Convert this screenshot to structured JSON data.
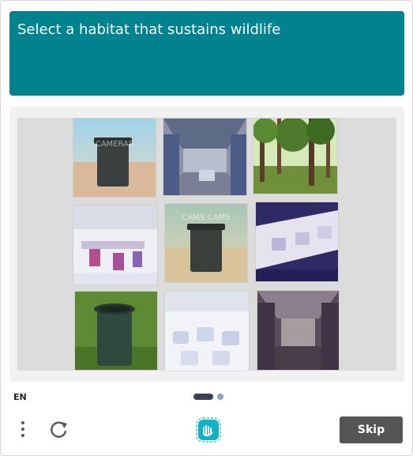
{
  "prompt": {
    "text": "Select a habitat that sustains wildlife"
  },
  "grid": {
    "tiles": [
      {
        "subject": "trash-can-desert",
        "watermark": "CAMERAS"
      },
      {
        "subject": "factory-hall"
      },
      {
        "subject": "forest"
      },
      {
        "subject": "factory-white"
      },
      {
        "subject": "trash-can-desert",
        "watermark": "CAMS CAMS"
      },
      {
        "subject": "factory-machinery-purple"
      },
      {
        "subject": "trash-can-grass"
      },
      {
        "subject": "factory-white-robots"
      },
      {
        "subject": "factory-hall-dark"
      }
    ]
  },
  "footer": {
    "language": "EN",
    "pager": {
      "current": 1,
      "total": 2
    },
    "skip_label": "Skip",
    "icons": [
      "more-vertical-icon",
      "refresh-icon",
      "hcaptcha-logo-icon"
    ]
  },
  "colors": {
    "prompt_bg": "#00838f",
    "skip_bg": "#555555",
    "pager_active": "#3c4251",
    "pager_dot": "#8ea3c0"
  }
}
